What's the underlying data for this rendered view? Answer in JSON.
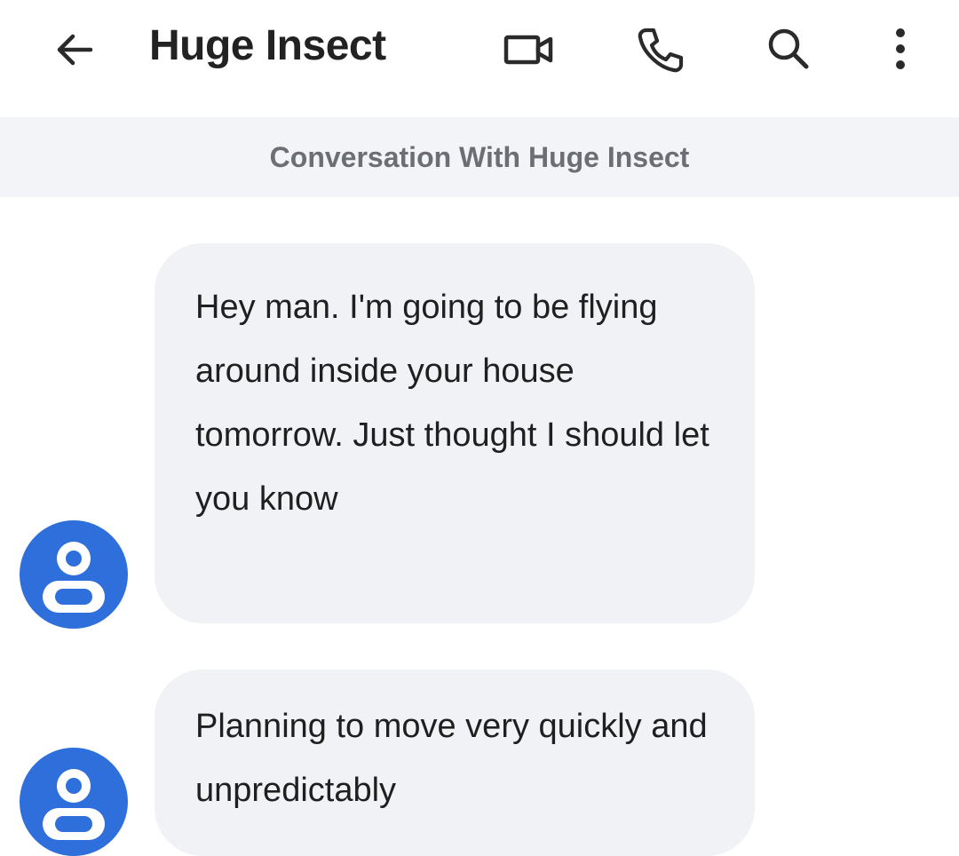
{
  "header": {
    "title": "Huge Insect",
    "icons": {
      "back": "arrow-left-icon",
      "video": "video-camera-icon",
      "call": "phone-icon",
      "search": "search-icon",
      "more": "more-vertical-icon"
    }
  },
  "conversation": {
    "banner": "Conversation With Huge Insect"
  },
  "messages": [
    {
      "sender": "Huge Insect",
      "text": "Hey man. I'm going to be flying around inside your house tomorrow. Just thought I should let you know"
    },
    {
      "sender": "Huge Insect",
      "text": "Planning to move very quickly and unpredictably"
    }
  ],
  "colors": {
    "accent": "#2f6fdb",
    "bubble": "#f0f2f5",
    "banner_bg": "#f2f4f7",
    "banner_text": "#6b6f75",
    "icon": "#2a2a2a"
  }
}
